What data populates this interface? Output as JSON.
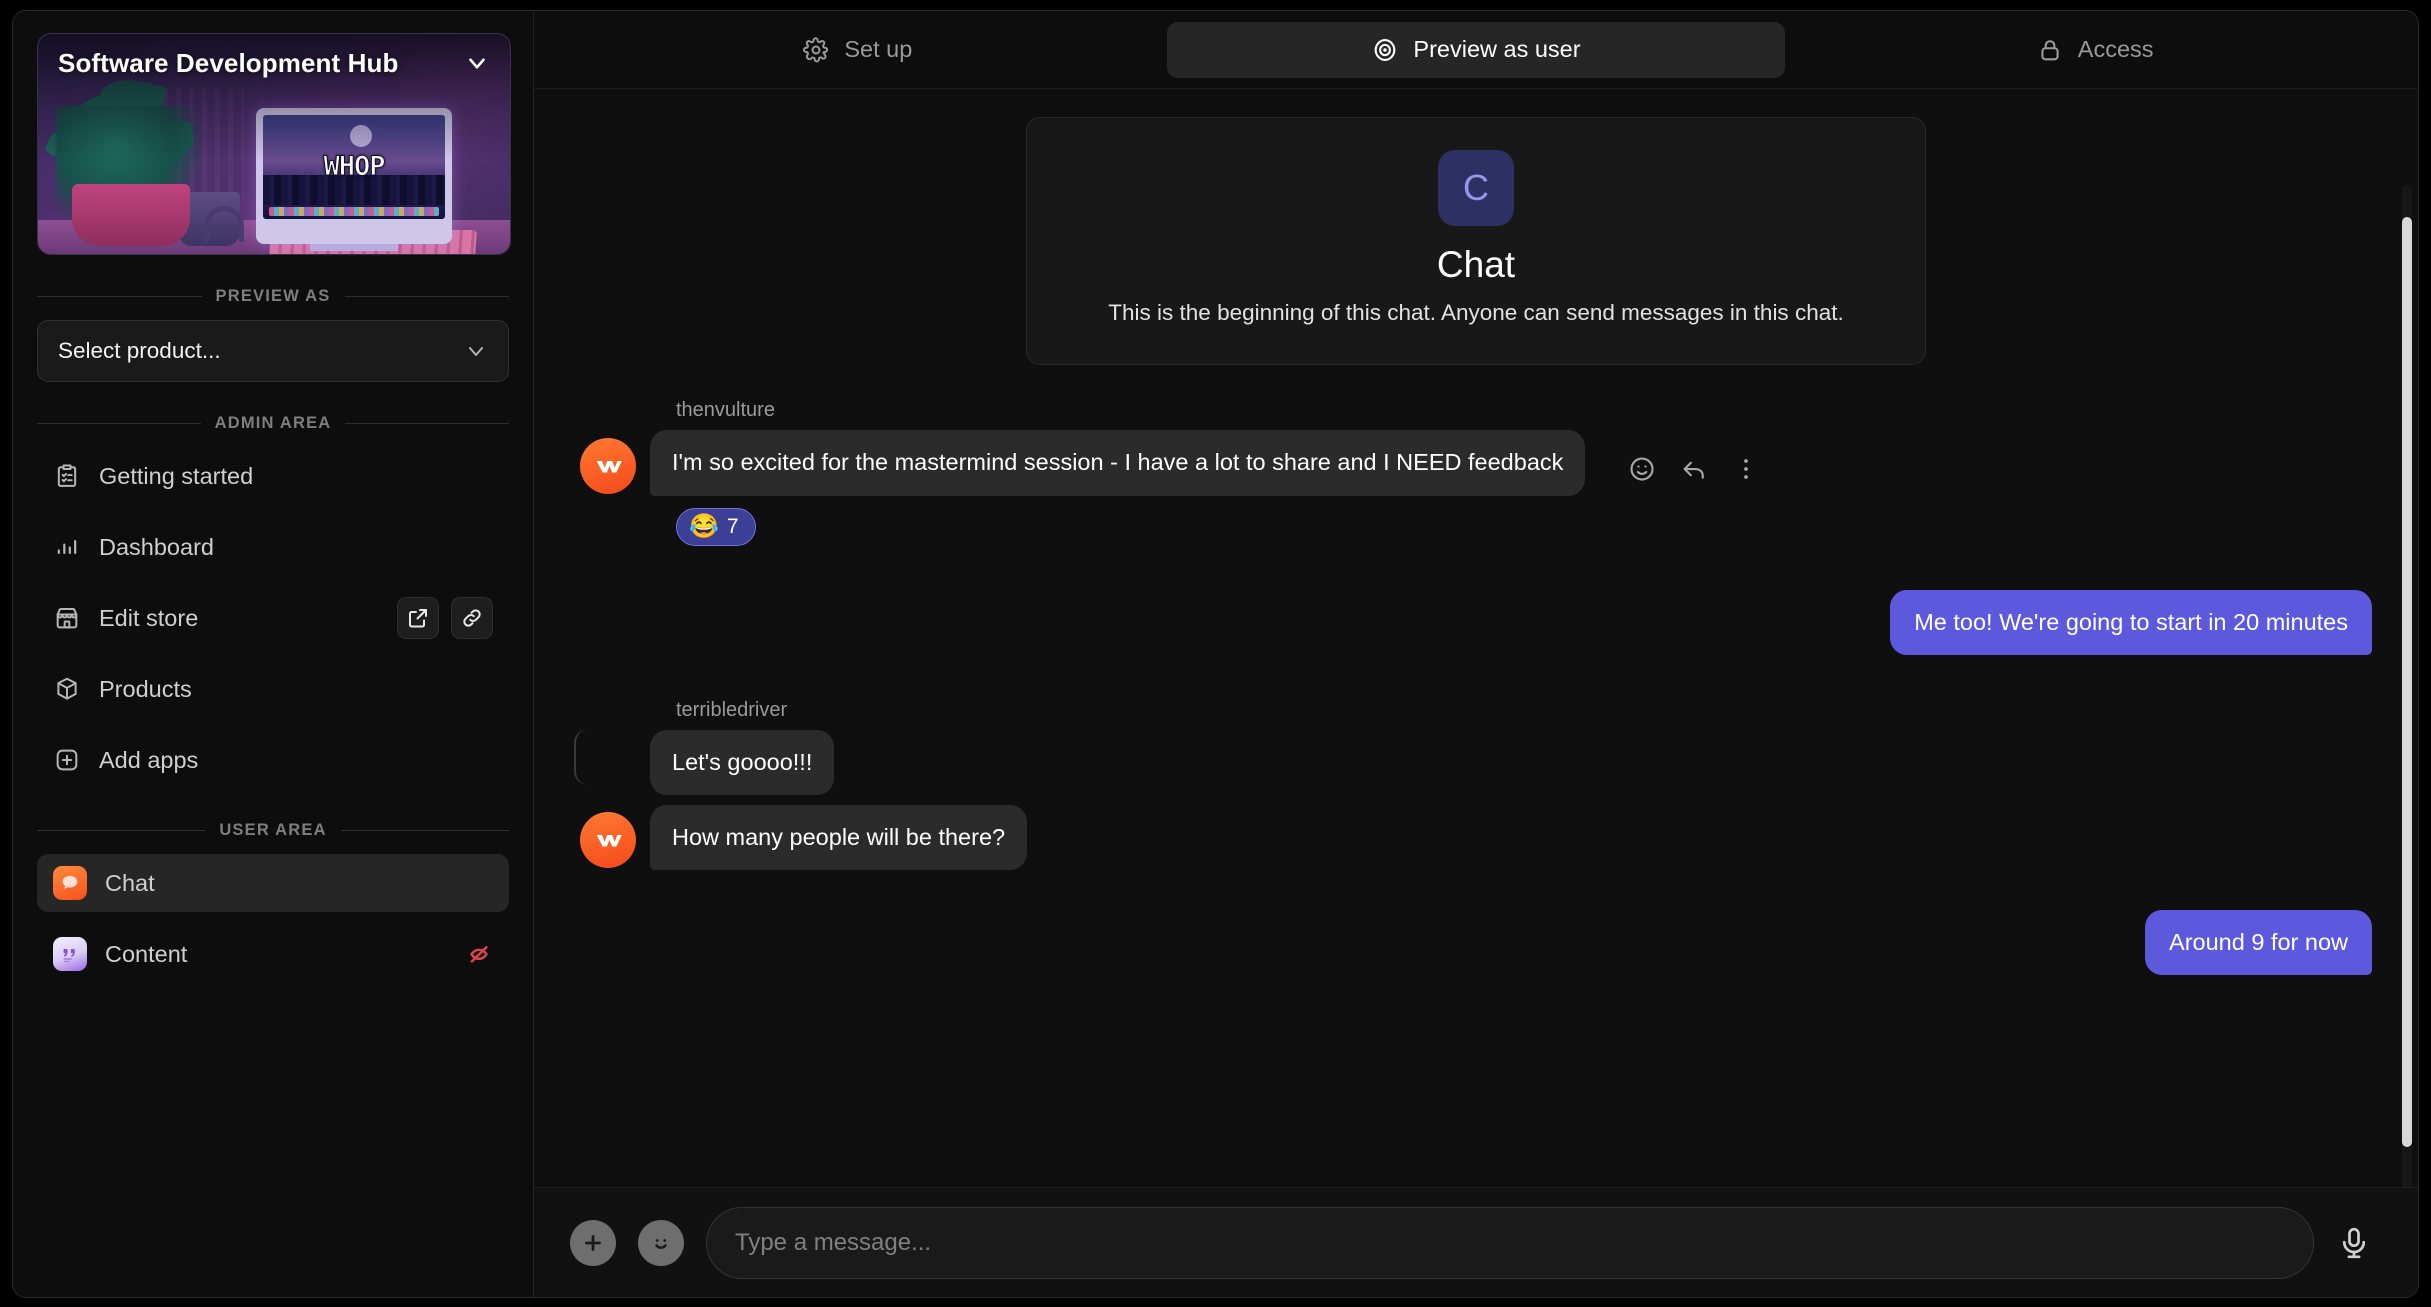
{
  "sidebar": {
    "store": {
      "title": "Software Development Hub",
      "logo_text": "WHOP",
      "chevron_icon": "chevron-down-icon"
    },
    "preview_section_label": "PREVIEW AS",
    "select_product": {
      "value": "Select product...",
      "chevron_icon": "chevron-down-icon"
    },
    "admin_section_label": "ADMIN AREA",
    "admin_items": [
      {
        "label": "Getting started",
        "icon": "clipboard-check-icon"
      },
      {
        "label": "Dashboard",
        "icon": "bar-chart-icon"
      },
      {
        "label": "Edit store",
        "icon": "storefront-icon",
        "actions": [
          "external-link-icon",
          "chain-link-icon"
        ]
      },
      {
        "label": "Products",
        "icon": "cube-icon"
      },
      {
        "label": "Add apps",
        "icon": "plus-square-icon"
      }
    ],
    "user_section_label": "USER AREA",
    "user_items": [
      {
        "label": "Chat",
        "icon": "chat-bubble-app-icon",
        "active": true
      },
      {
        "label": "Content",
        "icon": "quote-app-icon",
        "active": false,
        "status_icon": "eye-off-icon"
      }
    ]
  },
  "tabs": [
    {
      "label": "Set up",
      "icon": "gear-icon",
      "active": false
    },
    {
      "label": "Preview as user",
      "icon": "target-eye-icon",
      "active": true
    },
    {
      "label": "Access",
      "icon": "lock-icon",
      "active": false
    }
  ],
  "chat": {
    "intro": {
      "avatar_letter": "C",
      "title": "Chat",
      "description": "This is the beginning of this chat. Anyone can send messages in this chat."
    },
    "messages": [
      {
        "author": "thenvulture",
        "direction": "in",
        "text": "I'm so excited for the mastermind session - I have a lot to share and I NEED feedback",
        "reaction": {
          "emoji": "😂",
          "count": "7"
        },
        "actions": [
          "emoji-reaction-icon",
          "reply-icon",
          "more-options-icon"
        ]
      },
      {
        "direction": "out",
        "text": "Me too! We're going to start in 20 minutes"
      },
      {
        "author": "terribledriver",
        "direction": "in",
        "text": "Let's goooo!!!"
      },
      {
        "direction": "in",
        "text": "How many people will be there?"
      },
      {
        "direction": "out",
        "text": "Around 9 for now"
      }
    ],
    "composer": {
      "placeholder": "Type a message...",
      "add_icon": "plus-icon",
      "emoji_icon": "smiley-icon",
      "mic_icon": "microphone-icon"
    }
  },
  "colors": {
    "accent_purple": "#5d59dc",
    "reaction_pill": "#3b3f95",
    "chat_app_orange": "#f5521f",
    "hidden_red": "#e0454a",
    "active_tab_bg": "#262626"
  }
}
